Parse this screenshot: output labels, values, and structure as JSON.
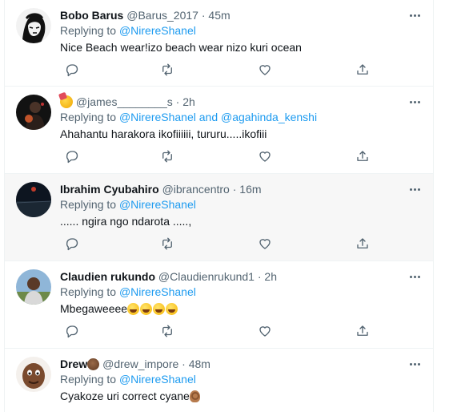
{
  "replies": [
    {
      "name": "Bobo Barus",
      "handle": "@Barus_2017",
      "dot": "·",
      "time": "45m",
      "replying_prefix": "Replying to",
      "mentions": [
        "@NirereShanel"
      ],
      "text": "Nice Beach wear!izo beach wear nizo kuri ocean",
      "avatar_icon": "che-guevara-avatar"
    },
    {
      "name": "",
      "name_badge_icon": "party-face-emoji",
      "handle": "@james________s",
      "dot": "·",
      "time": "2h",
      "replying_prefix": "Replying to",
      "mentions": [
        "@NirereShanel",
        "@agahinda_kenshi"
      ],
      "mention_joiner": "and",
      "text": "Ahahantu harakora ikofiiiiii, tururu.....ikofiii",
      "avatar_icon": "person-avatar-dark"
    },
    {
      "name": "Ibrahim Cyubahiro",
      "handle": "@ibrancentro",
      "dot": "·",
      "time": "16m",
      "replying_prefix": "Replying to",
      "mentions": [
        "@NirereShanel"
      ],
      "text": "...... ngira ngo ndarota .....,",
      "avatar_icon": "night-landscape-avatar",
      "highlighted": true
    },
    {
      "name": "Claudien rukundo",
      "handle": "@Claudienrukund1",
      "dot": "·",
      "time": "2h",
      "replying_prefix": "Replying to",
      "mentions": [
        "@NirereShanel"
      ],
      "text": "Mbegaweeee",
      "text_emojis": [
        "zany-face-emoji",
        "zany-face-emoji",
        "zany-face-emoji",
        "zany-face-emoji"
      ],
      "avatar_icon": "person-avatar-outdoor"
    },
    {
      "name": "Drew",
      "name_badge_icon": "face-emoji-dark",
      "handle": "@drew_impore",
      "dot": "·",
      "time": "48m",
      "replying_prefix": "Replying to",
      "mentions": [
        "@NirereShanel"
      ],
      "text": "Cyakoze uri correct cyane",
      "text_emojis": [
        "ok-hand-emoji"
      ],
      "avatar_icon": "cartoon-face-avatar"
    }
  ],
  "action_icons": [
    "reply-icon",
    "retweet-icon",
    "like-icon",
    "share-icon"
  ],
  "colors": {
    "accent": "#1d9bf0",
    "secondary_text": "#536471",
    "highlight_bg": "#f7f7f7",
    "border": "#eff3f4"
  }
}
